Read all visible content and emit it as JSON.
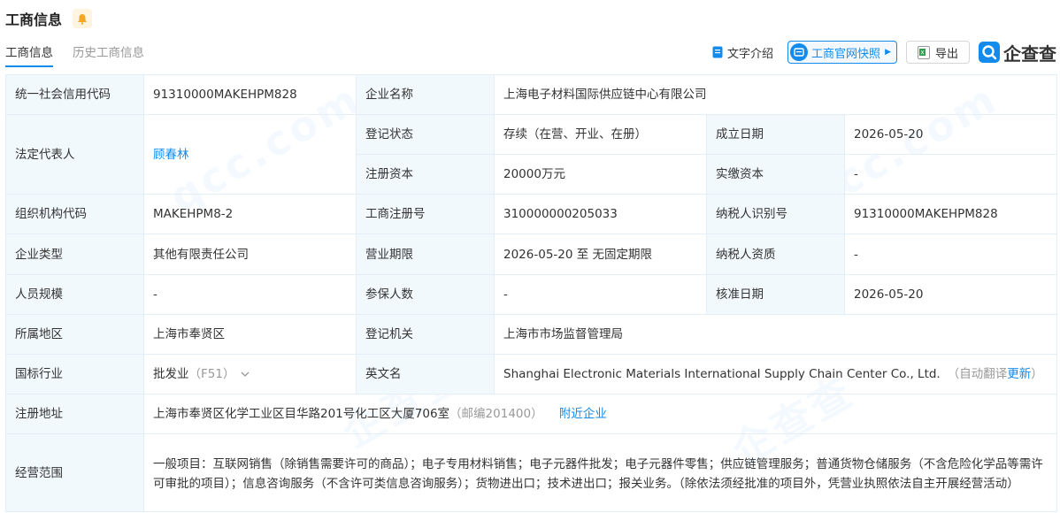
{
  "header": {
    "title": "工商信息"
  },
  "tabs": [
    {
      "label": "工商信息"
    },
    {
      "label": "历史工商信息"
    }
  ],
  "toolbar": {
    "text_intro": "文字介绍",
    "snapshot": "工商官网快照",
    "export": "导出",
    "logo": "企查查"
  },
  "rows": {
    "credit_code": {
      "label": "统一社会信用代码",
      "value": "91310000MAKEHPM828"
    },
    "company_name": {
      "label": "企业名称",
      "value": "上海电子材料国际供应链中心有限公司"
    },
    "legal_rep": {
      "label": "法定代表人",
      "value": "顾春林"
    },
    "reg_status": {
      "label": "登记状态",
      "value": "存续（在营、开业、在册）"
    },
    "found_date": {
      "label": "成立日期",
      "value": "2026-05-20"
    },
    "reg_capital": {
      "label": "注册资本",
      "value": "20000万元"
    },
    "paid_capital": {
      "label": "实缴资本",
      "value": "-"
    },
    "org_code": {
      "label": "组织机构代码",
      "value": "MAKEHPM8-2"
    },
    "reg_no": {
      "label": "工商注册号",
      "value": "310000000205033"
    },
    "taxpayer_id": {
      "label": "纳税人识别号",
      "value": "91310000MAKEHPM828"
    },
    "company_type": {
      "label": "企业类型",
      "value": "其他有限责任公司"
    },
    "biz_term": {
      "label": "营业期限",
      "value": "2026-05-20 至 无固定期限"
    },
    "taxpayer_qual": {
      "label": "纳税人资质",
      "value": "-"
    },
    "staff_size": {
      "label": "人员规模",
      "value": "-"
    },
    "insured": {
      "label": "参保人数",
      "value": "-"
    },
    "approve_date": {
      "label": "核准日期",
      "value": "2026-05-20"
    },
    "region": {
      "label": "所属地区",
      "value": "上海市奉贤区"
    },
    "reg_authority": {
      "label": "登记机关",
      "value": "上海市市场监督管理局"
    },
    "industry": {
      "label": "国标行业",
      "value": "批发业",
      "code": "（F51）"
    },
    "english_name": {
      "label": "英文名",
      "value": "Shanghai Electronic Materials International Supply Chain Center Co., Ltd.",
      "note": "（自动翻译",
      "update": "更新",
      "note_end": "）"
    },
    "address": {
      "label": "注册地址",
      "value": "上海市奉贤区化学工业区目华路201号化工区大厦706室",
      "postcode": "（邮编201400）",
      "nearby": "附近企业"
    },
    "scope": {
      "label": "经营范围",
      "value": "一般项目：互联网销售（除销售需要许可的商品）；电子专用材料销售；电子元器件批发；电子元器件零售；供应链管理服务；普通货物仓储服务（不含危险化学品等需许可审批的项目）；信息咨询服务（不含许可类信息咨询服务）；货物进出口；技术进出口；报关业务。（除依法须经批准的项目外，凭营业执照依法自主开展经营活动）"
    }
  }
}
